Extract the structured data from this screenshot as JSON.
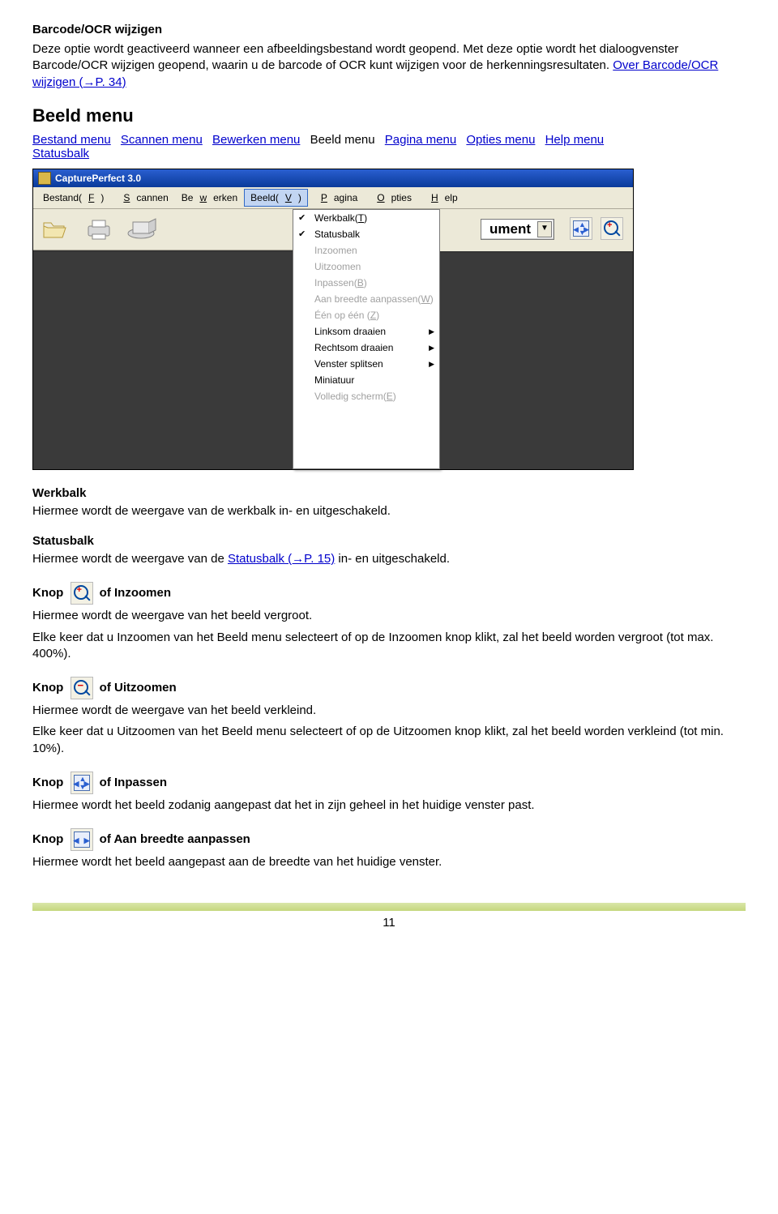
{
  "top": {
    "title": "Barcode/OCR wijzigen",
    "p1a": "Deze optie wordt geactiveerd wanneer een afbeeldingsbestand wordt geopend. Met deze optie wordt het dialoogvenster Barcode/OCR wijzigen geopend, waarin u de barcode of OCR kunt wijzigen voor de herkenningsresultaten. ",
    "link": "Over Barcode/OCR wijzigen (→P. 34)"
  },
  "heading": "Beeld menu",
  "nav": {
    "items": [
      "Bestand menu",
      "Scannen menu",
      "Bewerken menu",
      "Beeld menu",
      "Pagina menu",
      "Opties menu",
      "Help menu"
    ],
    "statusbalk": "Statusbalk",
    "plain_index": 3
  },
  "app": {
    "title": "CapturePerfect 3.0",
    "menubar": [
      {
        "pre": "Bestand(",
        "u": "F",
        "post": ")"
      },
      {
        "pre": "",
        "u": "S",
        "post": "cannen"
      },
      {
        "pre": "Be",
        "u": "w",
        "post": "erken"
      },
      {
        "pre": "Beeld(",
        "u": "V",
        "post": ")"
      },
      {
        "pre": "",
        "u": "P",
        "post": "agina"
      },
      {
        "pre": "",
        "u": "O",
        "post": "pties"
      },
      {
        "pre": "",
        "u": "H",
        "post": "elp"
      }
    ],
    "active_index": 3,
    "dropdown": [
      {
        "label": "Werkbalk(T)",
        "checked": true
      },
      {
        "label": "Statusbalk",
        "checked": true
      },
      {
        "label": "Inzoomen",
        "disabled": true
      },
      {
        "label": "Uitzoomen",
        "disabled": true
      },
      {
        "label": "Inpassen(B)",
        "disabled": true
      },
      {
        "label": "Aan breedte aanpassen(W)",
        "disabled": true
      },
      {
        "label": "Één op één (Z)",
        "disabled": true
      },
      {
        "label": "Linksom draaien",
        "hassub": true
      },
      {
        "label": "Rechtsom draaien",
        "hassub": true
      },
      {
        "label": "Venster splitsen",
        "hassub": true
      },
      {
        "label": "Miniatuur"
      },
      {
        "label": "Volledig scherm(E)",
        "disabled": true
      }
    ],
    "ument": "ument"
  },
  "sections": {
    "werkbalk": {
      "title": "Werkbalk",
      "text": "Hiermee wordt de weergave van de werkbalk in- en uitgeschakeld."
    },
    "statusbalk": {
      "title": "Statusbalk",
      "t1": "Hiermee wordt de weergave van de ",
      "link": "Statusbalk (→P. 15)",
      "t2": " in- en uitgeschakeld."
    },
    "inzoomen": {
      "knop": "Knop",
      "suffix": " of Inzoomen",
      "l1": "Hiermee wordt de weergave van het beeld vergroot.",
      "l2": "Elke keer dat u Inzoomen van het Beeld menu selecteert of op de Inzoomen knop klikt, zal het beeld worden vergroot (tot max. 400%)."
    },
    "uitzoomen": {
      "knop": "Knop",
      "suffix": " of Uitzoomen",
      "l1": "Hiermee wordt de weergave van het beeld verkleind.",
      "l2": "Elke keer dat u Uitzoomen van het Beeld menu selecteert of op de Uitzoomen knop klikt, zal het beeld worden verkleind (tot min. 10%)."
    },
    "inpassen": {
      "knop": "Knop",
      "suffix": " of Inpassen",
      "l1": "Hiermee wordt het beeld zodanig aangepast dat het in zijn geheel in het huidige venster past."
    },
    "breedte": {
      "knop": "Knop",
      "suffix": " of Aan breedte aanpassen",
      "l1": "Hiermee wordt het beeld aangepast aan de breedte van het huidige venster."
    }
  },
  "page_num": "11"
}
